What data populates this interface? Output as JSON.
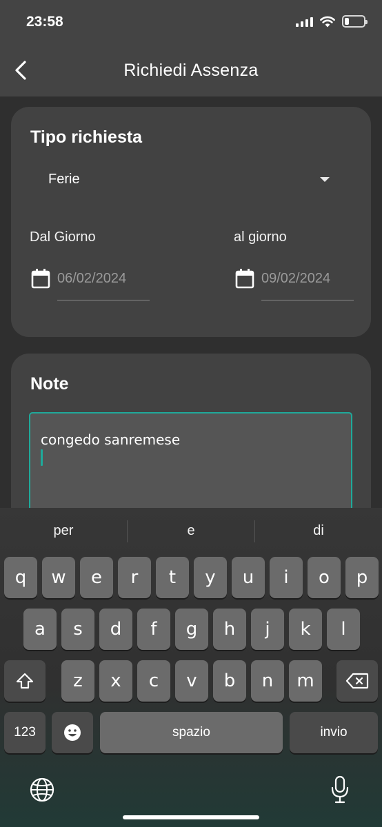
{
  "status_bar": {
    "time": "23:58"
  },
  "header": {
    "title": "Richiedi Assenza"
  },
  "request_card": {
    "title": "Tipo richiesta",
    "type_value": "Ferie",
    "from_label": "Dal Giorno",
    "to_label": "al giorno",
    "from_date": "06/02/2024",
    "to_date": "09/02/2024"
  },
  "note_card": {
    "title": "Note",
    "text": "congedo sanremese"
  },
  "keyboard": {
    "suggestions": [
      "per",
      "e",
      "di"
    ],
    "row1": [
      "q",
      "w",
      "e",
      "r",
      "t",
      "y",
      "u",
      "i",
      "o",
      "p"
    ],
    "row2": [
      "a",
      "s",
      "d",
      "f",
      "g",
      "h",
      "j",
      "k",
      "l"
    ],
    "row3": [
      "z",
      "x",
      "c",
      "v",
      "b",
      "n",
      "m"
    ],
    "numbers_label": "123",
    "space_label": "spazio",
    "return_label": "invio"
  },
  "colors": {
    "accent": "#1fa99a",
    "card": "#424242",
    "header": "#444444"
  }
}
